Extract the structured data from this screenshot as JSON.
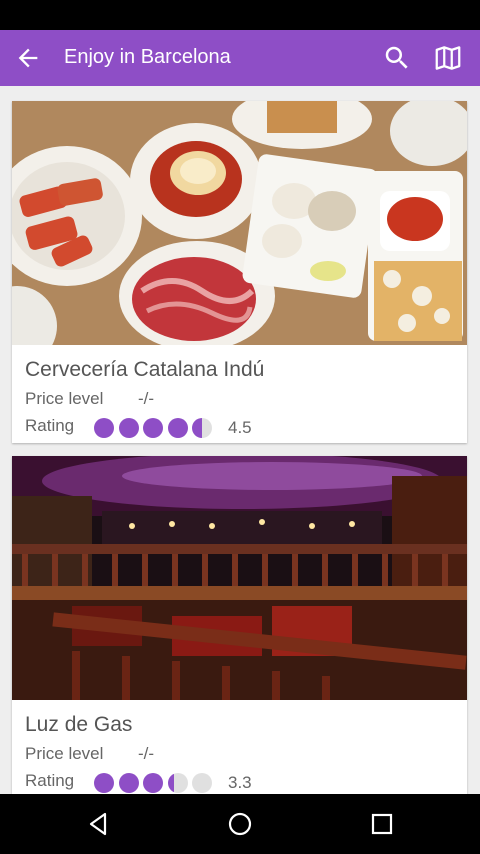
{
  "app": {
    "title": "Enjoy in Barcelona",
    "accent_color": "#8e4ec6",
    "back_icon": "arrow-back-icon",
    "search_icon": "search-icon",
    "map_icon": "map-icon"
  },
  "listings": [
    {
      "name": "Cervecería Catalana Indú",
      "price_label": "Price level",
      "price_value": "-/-",
      "rating_label": "Rating",
      "rating": 4.5,
      "rating_text": "4.5",
      "image": "tapas-food-photo"
    },
    {
      "name": "Luz de Gas",
      "price_label": "Price level",
      "price_value": "-/-",
      "rating_label": "Rating",
      "rating": 3.3,
      "rating_text": "3.3",
      "image": "venue-interior-photo"
    }
  ],
  "rating_colors": {
    "filled": "#8e4ec6",
    "empty": "#e0e0e0"
  },
  "navigation": {
    "back": "nav-back-icon",
    "home": "nav-home-icon",
    "recents": "nav-recents-icon"
  }
}
